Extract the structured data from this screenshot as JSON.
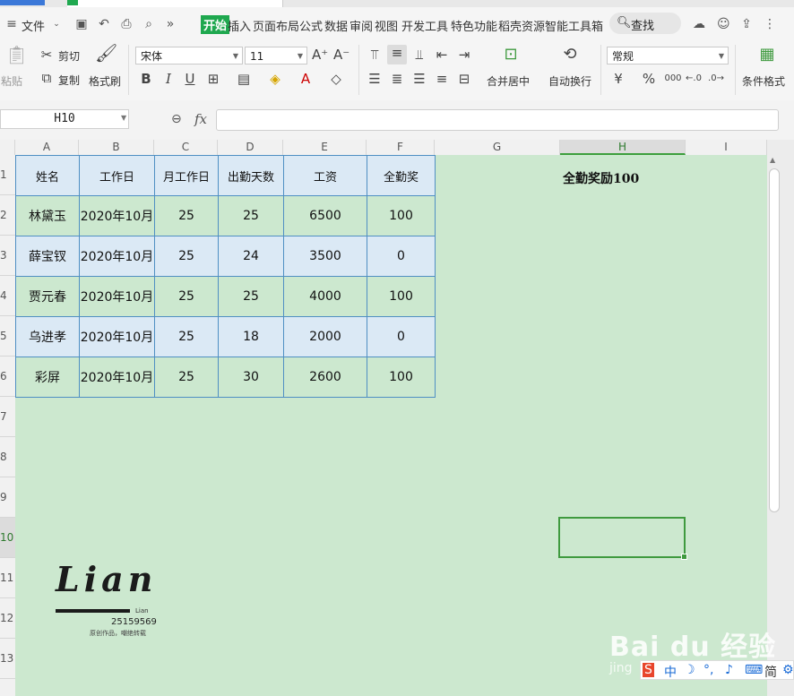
{
  "menu": {
    "file": "文件",
    "tabs": [
      "开始",
      "插入",
      "页面布局",
      "公式",
      "数据",
      "审阅",
      "视图",
      "开发工具",
      "特色功能",
      "稻壳资源",
      "智能工具箱"
    ],
    "search": "查找"
  },
  "ribbon": {
    "paste": "粘贴",
    "cut": "剪切",
    "copy": "复制",
    "format_painter": "格式刷",
    "font_name": "宋体",
    "font_size": "11",
    "bold": "B",
    "italic": "I",
    "underline": "U",
    "merge_center": "合并居中",
    "wrap_text": "自动换行",
    "number_format": "常规",
    "currency": "¥",
    "percent": "%",
    "thousands": "000",
    "cond_format": "条件格式"
  },
  "formula_bar": {
    "name_box": "H10",
    "fx": "fx",
    "value": ""
  },
  "columns": [
    "A",
    "B",
    "C",
    "D",
    "E",
    "F",
    "G",
    "H",
    "I"
  ],
  "rows": [
    "1",
    "2",
    "3",
    "4",
    "5",
    "6",
    "7",
    "8",
    "9",
    "10",
    "11",
    "12",
    "13"
  ],
  "active_cell": {
    "col": "H",
    "row": "10"
  },
  "table": {
    "headers": [
      "姓名",
      "工作日",
      "月工作日",
      "出勤天数",
      "工资",
      "全勤奖"
    ],
    "rows": [
      [
        "林黛玉",
        "2020年10月",
        "25",
        "25",
        "6500",
        "100"
      ],
      [
        "薛宝钗",
        "2020年10月",
        "25",
        "24",
        "3500",
        "0"
      ],
      [
        "贾元春",
        "2020年10月",
        "25",
        "25",
        "4000",
        "100"
      ],
      [
        "乌进孝",
        "2020年10月",
        "25",
        "18",
        "2000",
        "0"
      ],
      [
        "彩屏",
        "2020年10月",
        "25",
        "30",
        "2600",
        "100"
      ]
    ]
  },
  "note": "全勤奖励100",
  "logo": {
    "title": "Lian",
    "sub": "Lian",
    "number": "25159569",
    "caption": "原创作品，嘲绝转载"
  },
  "watermark": {
    "main": "Bai du 经验",
    "sub": "jing"
  },
  "ime": {
    "items": [
      "中",
      "简"
    ]
  },
  "colors": {
    "sheet_bg": "#cce8cf",
    "header_bg": "#dbe9f5",
    "border": "#4f8fc3",
    "active": "#3f9a3f",
    "tab_active": "#1fa84f"
  }
}
